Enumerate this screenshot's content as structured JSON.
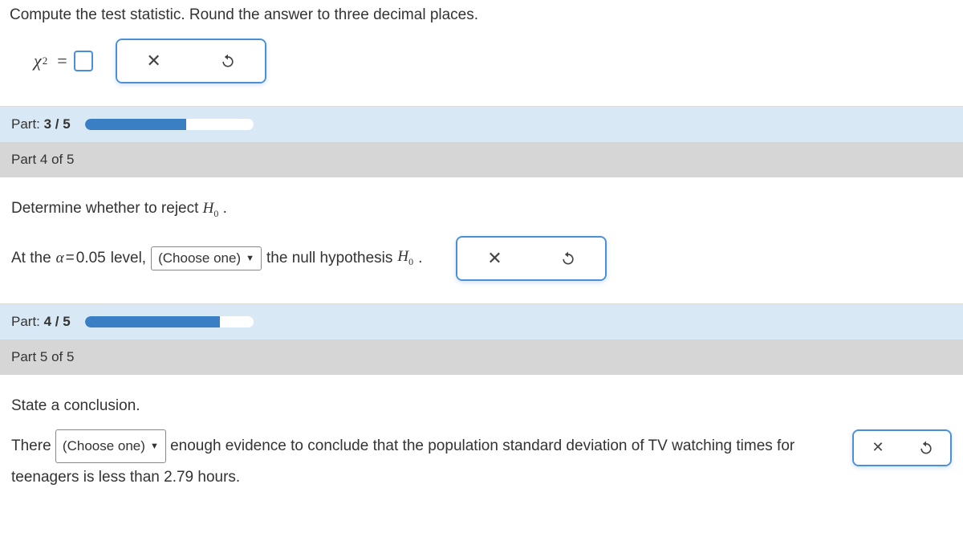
{
  "q1": {
    "prompt": "Compute the test statistic. Round the answer to three decimal places."
  },
  "progress3": {
    "label_prefix": "Part: ",
    "label_value": "3 / 5",
    "percent": 60
  },
  "part4": {
    "header": "Part 4 of 5",
    "prompt_prefix": "Determine whether to reject ",
    "line_before": "At the ",
    "alpha_value": "0.05",
    "line_after_alpha": " level, ",
    "dropdown": "(Choose one)",
    "line_after_drop": " the null hypothesis "
  },
  "progress4": {
    "label_prefix": "Part: ",
    "label_value": "4 / 5",
    "percent": 80
  },
  "part5": {
    "header": "Part 5 of 5",
    "prompt": "State a conclusion.",
    "there": "There ",
    "dropdown": "(Choose one)",
    "after_drop": " enough evidence to conclude that the population standard deviation of TV watching times for",
    "line2_a": "teenagers is less than ",
    "value": "2.79",
    "line2_b": " hours."
  }
}
